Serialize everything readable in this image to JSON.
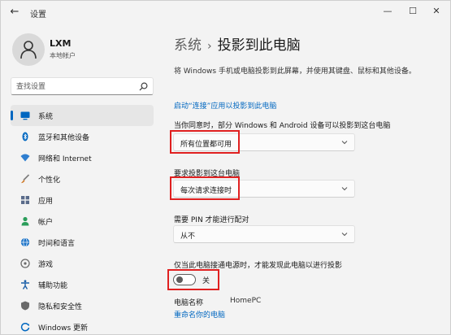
{
  "window": {
    "title": "设置"
  },
  "account": {
    "name": "LXM",
    "type": "本地帐户"
  },
  "search": {
    "placeholder": "查找设置"
  },
  "sidebar": {
    "items": [
      {
        "label": "系统",
        "icon": "monitor-icon",
        "color": "#0067c0",
        "active": true
      },
      {
        "label": "蓝牙和其他设备",
        "icon": "bluetooth-icon",
        "color": "#0067c0"
      },
      {
        "label": "网络和 Internet",
        "icon": "wifi-icon",
        "color": "#2f7fd0"
      },
      {
        "label": "个性化",
        "icon": "brush-icon",
        "color": "#d07c2c"
      },
      {
        "label": "应用",
        "icon": "apps-icon",
        "color": "#5a6b8a"
      },
      {
        "label": "帐户",
        "icon": "person-icon",
        "color": "#2a9d5a"
      },
      {
        "label": "时间和语言",
        "icon": "globe-icon",
        "color": "#1e74c8"
      },
      {
        "label": "游戏",
        "icon": "gamepad-icon",
        "color": "#6a6a6a"
      },
      {
        "label": "辅助功能",
        "icon": "accessibility-icon",
        "color": "#1b5fa8"
      },
      {
        "label": "隐私和安全性",
        "icon": "shield-icon",
        "color": "#6a6a6a"
      },
      {
        "label": "Windows 更新",
        "icon": "update-icon",
        "color": "#0067c0"
      }
    ]
  },
  "main": {
    "breadcrumb": {
      "parent": "系统",
      "separator": "›",
      "current": "投影到此电脑"
    },
    "description": "将 Windows 手机或电脑投影到此屏幕，并使用其键盘、鼠标和其他设备。",
    "connect_link": "启动“连接”应用以投影到此电脑",
    "settings": [
      {
        "label": "当你同意时，部分 Windows 和 Android 设备可以投影到这台电脑",
        "value": "所有位置都可用"
      },
      {
        "label": "要求投影到这台电脑",
        "value": "每次请求连接时"
      },
      {
        "label": "需要 PIN 才能进行配对",
        "value": "从不"
      }
    ],
    "power": {
      "label": "仅当此电脑接通电源时，才能发现此电脑以进行投影",
      "toggle_text": "关"
    },
    "pc": {
      "label": "电脑名称",
      "value": "HomePC",
      "rename_link": "重命名你的电脑"
    }
  },
  "colors": {
    "accent": "#0067c0",
    "highlight": "#e02020"
  }
}
